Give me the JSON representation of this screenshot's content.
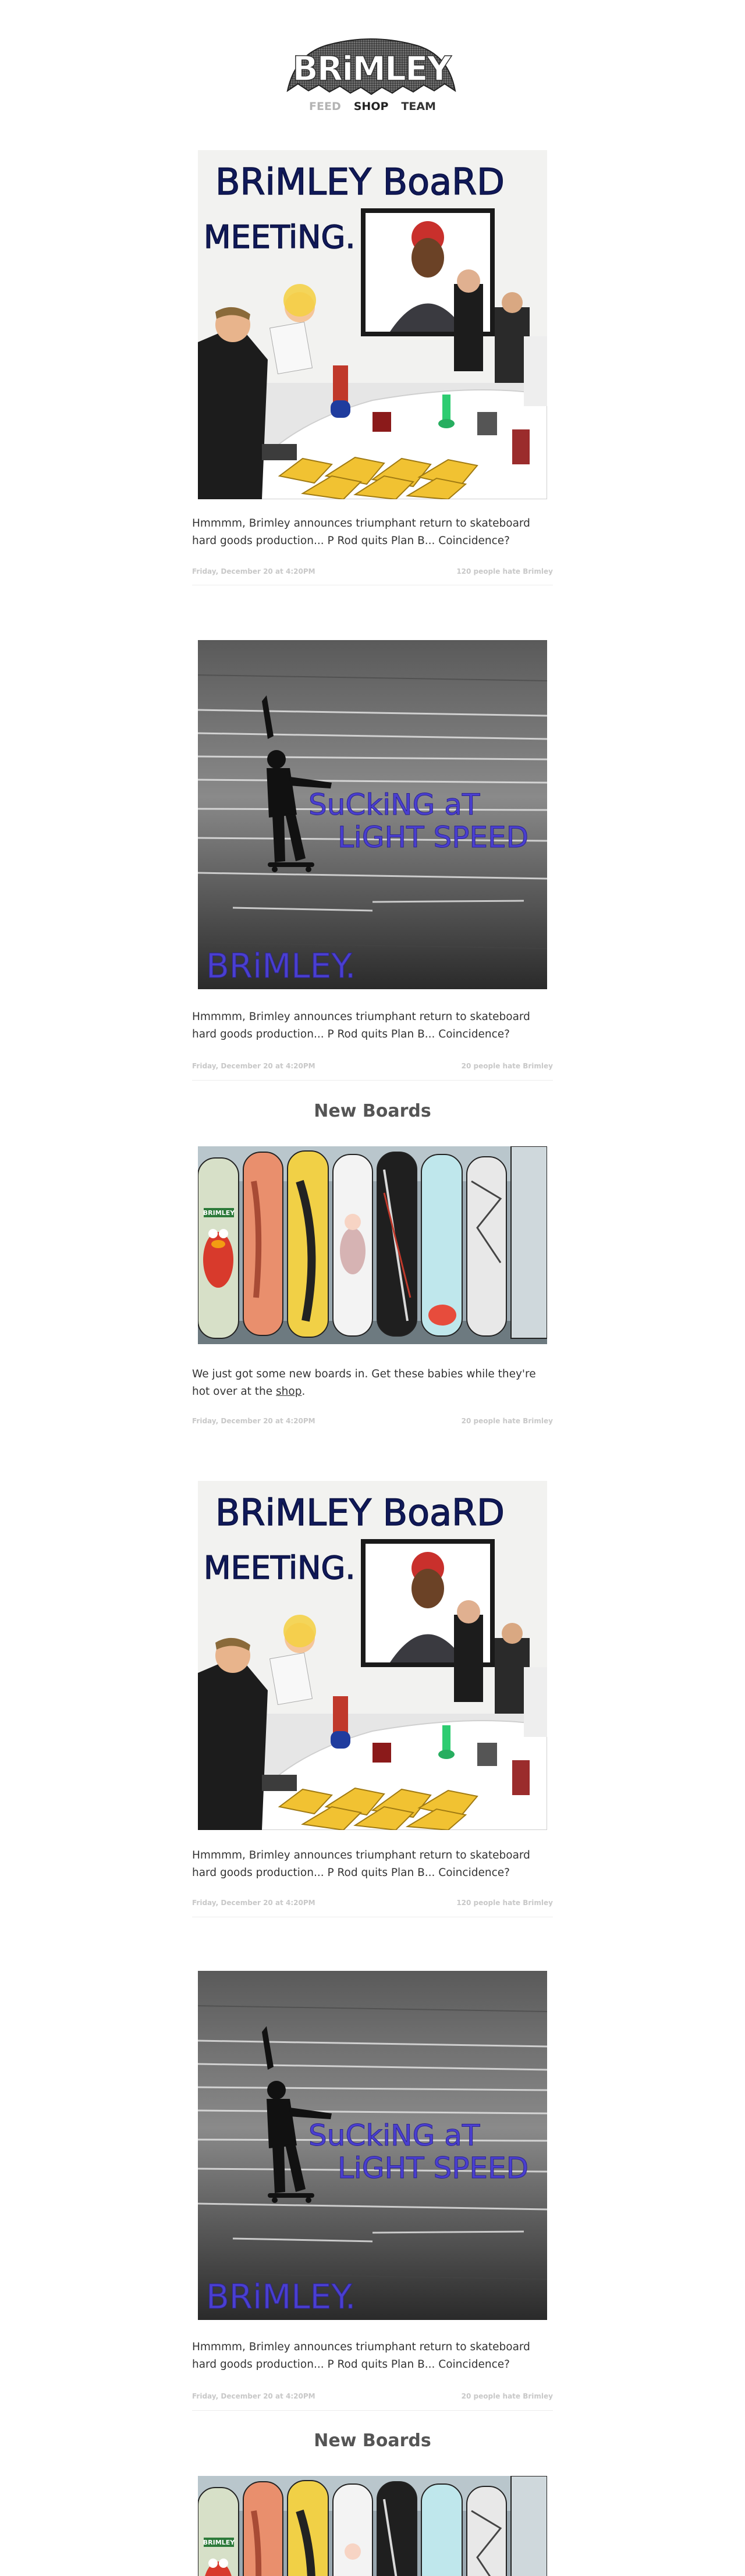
{
  "brand": {
    "logo_text": "BRiMLEY"
  },
  "nav": {
    "feed": "FEED",
    "shop": "SHOP",
    "team": "TEAM"
  },
  "posts": [
    {
      "type": "image-post",
      "image_title_line1": "BRiMLEY BoaRD",
      "image_title_line2": "MEETiNG.",
      "text": "Hmmmm, Brimley announces triumphant return to skateboard hard goods production... P Rod quits Plan B... Coincidence?",
      "date": "Friday, December 20 at 4:20PM",
      "hate": "120 people hate Brimley"
    },
    {
      "type": "image-post",
      "image_caption_line1": "SuCkiNG aT",
      "image_caption_line2": "LiGHT SPEED",
      "image_brand": "BRiMLEY.",
      "text": "Hmmmm, Brimley announces triumphant return to skateboard hard goods production... P Rod quits Plan B... Coincidence?",
      "date": "Friday, December 20 at 4:20PM",
      "hate": "20 people hate Brimley"
    },
    {
      "type": "boards-post",
      "heading": "New Boards",
      "board_label": "BRIMLEY",
      "text_before": "We just got some new boards in. Get these babies while they're hot over at the ",
      "link": "shop",
      "text_after": ".",
      "date": "Friday, December 20 at 4:20PM",
      "hate": "20 people hate Brimley"
    },
    {
      "type": "image-post",
      "image_title_line1": "BRiMLEY BoaRD",
      "image_title_line2": "MEETiNG.",
      "text": "Hmmmm, Brimley announces triumphant return to skateboard hard goods production... P Rod quits Plan B... Coincidence?",
      "date": "Friday, December 20 at 4:20PM",
      "hate": "120 people hate Brimley"
    },
    {
      "type": "image-post",
      "image_caption_line1": "SuCkiNG aT",
      "image_caption_line2": "LiGHT SPEED",
      "image_brand": "BRiMLEY.",
      "text": "Hmmmm, Brimley announces triumphant return to skateboard hard goods production... P Rod quits Plan B... Coincidence?",
      "date": "Friday, December 20 at 4:20PM",
      "hate": "20 people hate Brimley"
    },
    {
      "type": "boards-post",
      "heading": "New Boards",
      "board_label": "BRIMLEY"
    }
  ],
  "colors": {
    "background": "#ffffff",
    "text": "#333333",
    "nav_inactive": "#b3b3b3",
    "nav_active": "#222222",
    "meta": "#c8c8c8",
    "marker_navy": "#10195a",
    "marker_purple": "#4a3fd0"
  }
}
